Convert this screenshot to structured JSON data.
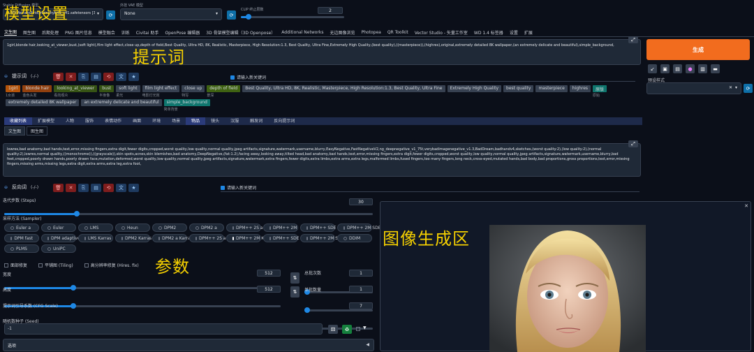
{
  "header": {
    "model_label": "Stable Diffusion 模型",
    "model_value": "2.5D\\Meinahybrid\\meinahybrid_v41.safetensors [3c9f4fd]",
    "vae_label": "外挂 VAE 模型",
    "vae_value": "None",
    "clip_label": "CLIP 终止层数",
    "clip_value": "2",
    "clip_fraction": 0.3
  },
  "tabs": [
    "文生图",
    "图生图",
    "后期处理",
    "PNG 图片信息",
    "模型融合",
    "训练",
    "Civitai 助手",
    "OpenPose 编辑器",
    "3D 骨架模型编辑（3D Openpose）",
    "Additional Networks",
    "无边图像浏览",
    "Photopea",
    "QR Toolkit",
    "Vector Studio - 矢量工作室",
    "WD 1.4 标签器",
    "设置",
    "扩展"
  ],
  "prompt": {
    "text": "1girl,blonde hair,looking_at_viewer,bust,(soft light),film light effect,close up,depth of field,Best Quality, Ultra HD, 8K, Realistic, Masterpiece, High Resolution:1.3, Best Quality, Ultra Fine,Extremely High Quality,(best quality),((masterpiece)),(highres),original,extremely detailed 8K wallpaper,(an extremely delicate and beautiful),simple_background,",
    "section_title": "提示词",
    "count": "(-/-)",
    "new_line_checkbox": "请输入新关键词"
  },
  "prompt_tags": [
    {
      "t": "1girl",
      "s": "1女孩",
      "c": "#b45309"
    },
    {
      "t": "blonde hair",
      "s": "金色头发",
      "c": "#92400e"
    },
    {
      "t": "looking_at_viewer",
      "s": "看向观众",
      "c": "#365314"
    },
    {
      "t": "bust",
      "s": "半身像",
      "c": "#365314"
    },
    {
      "t": "soft light",
      "s": "柔光",
      "c": "#374151"
    },
    {
      "t": "film light effect",
      "s": "电影灯光效",
      "c": "#374151"
    },
    {
      "t": "close up",
      "s": "特写",
      "c": "#374151"
    },
    {
      "t": "depth of field",
      "s": "景深",
      "c": "#3f6212"
    },
    {
      "t": "Best Quality, Ultra HD, 8K, Realistic, Masterpiece, High Resolution:1.3, Best Quality, Ultra Fine",
      "s": "",
      "c": "#374151"
    },
    {
      "t": "Extremely High Quality",
      "s": "",
      "c": "#374151"
    },
    {
      "t": "best quality",
      "s": "",
      "c": "#374151"
    },
    {
      "t": "masterpiece",
      "s": "",
      "c": "#374151"
    },
    {
      "t": "highres",
      "s": "",
      "c": "#374151"
    },
    {
      "t": "原版",
      "s": "原始",
      "c": "#0f766e"
    },
    {
      "t": "extremely detailed 8K wallpaper",
      "s": "",
      "c": "#374151"
    },
    {
      "t": "an extremely delicate and beautiful",
      "s": "",
      "c": "#374151"
    },
    {
      "t": "simple_background",
      "s": "简单背景",
      "c": "#0f766e"
    }
  ],
  "category_tabs": [
    "收藏列表",
    "扩展模型",
    "人物",
    "服饰",
    "表情动作",
    "画面",
    "环境",
    "场景",
    "物品",
    "镜头",
    "汉服",
    "触发词",
    "反向提示词"
  ],
  "sub_tabs": [
    "文生图",
    "图生图"
  ],
  "negative": {
    "text": "lowres,bad anatomy,bad hands,text,error,missing fingers,extra digit,fewer digits,cropped,worst quality,low quality,normal quality,jpeg artifacts,signature,watermark,username,blurry,EasyNegative,FastNegativeV2,ng_deepnegative_v1_75t,verybadimagenegative_v1.3,BadDream,badhandv4,sketches,(worst quality:2),(low quality:2),(normal quality:2),lowres,normal quality,((monochrome)),((grayscale)),skin spots,acnes,skin blemishes,bad anatomy,DeepNegative,(fat:1.2),facing away,looking away,tilted head,bad anatomy,bad hands,text,error,missing fingers,extra digit,fewer digits,cropped,worst quality,low quality,normal quality,jpeg artifacts,signature,watermark,username,blurry,bad feet,cropped,poorly drawn hands,poorly drawn face,mutation,deformed,worst quality,low quality,normal quality,jpeg artifacts,signature,watermark,extra fingers,fewer digits,extra limbs,extra arms,extra legs,malformed limbs,fused fingers,too many fingers,long neck,cross-eyed,mutated hands,bad body,bad proportions,gross proportions,text,error,missing fingers,missing arms,missing legs,extra digit,extra arms,extra leg,extra foot,",
    "section_title": "反向词",
    "count": "(-/-)",
    "new_line_checkbox": "请输入新关键词"
  },
  "params": {
    "steps_label": "迭代步数 (Steps)",
    "steps_value": "30",
    "steps_fraction": 0.2,
    "sampler_label": "采样方法 (Sampler)",
    "samplers": [
      "Euler a",
      "Euler",
      "LMS",
      "Heun",
      "DPM2",
      "DPM2 a",
      "DPM++ 2S a",
      "DPM++ 2M",
      "DPM++ SDE",
      "DPM++ 2M SDE",
      "DPM fast",
      "DPM adaptive",
      "LMS Karras",
      "DPM2 Karras",
      "DPM2 a Karras",
      "DPM++ 2S a Karras",
      "DPM++ 2M Karras",
      "DPM++ SDE Karras",
      "DPM++ 2M SDE Karras",
      "DDIM",
      "PLMS",
      "UniPC"
    ],
    "selected_sampler": "DPM++ 2M Karras",
    "checks": [
      "面部修复",
      "平铺图 (Tiling)",
      "高分辨率修复 (Hires. fix)"
    ],
    "width_label": "宽度",
    "width_value": "512",
    "width_fraction": 0.25,
    "height_label": "高度",
    "height_value": "512",
    "height_fraction": 0.25,
    "batch_count_label": "总批次数",
    "batch_count_value": "1",
    "batch_size_label": "单批数量",
    "batch_size_value": "1",
    "cfg_label": "提示词引导系数 (CFG Scale)",
    "cfg_value": "7",
    "cfg_fraction": 0.2,
    "seed_label": "随机数种子 (Seed)",
    "seed_value": "-1",
    "options_label": "选项"
  },
  "right": {
    "generate": "生成",
    "style_label": "预设样式",
    "style_value": ""
  },
  "annotations": {
    "model": "模型设置",
    "prompt": "提示词",
    "params": "参数",
    "image": "图像生成区"
  },
  "colors": {
    "generate": "#f26c1e",
    "accent": "#1e88e5",
    "annot": "#f5d000"
  }
}
